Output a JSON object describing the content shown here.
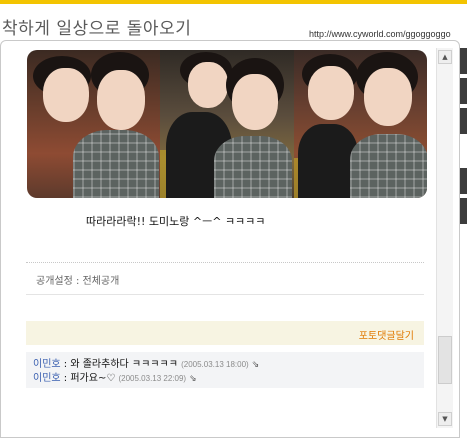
{
  "header": {
    "title": "착하게 일상으로 돌아오기",
    "url": "http://www.cyworld.com/ggoggoggo"
  },
  "post": {
    "caption": "따라라라락!! 도미노랑 ^ㅡ^ ㅋㅋㅋㅋ",
    "privacy": "공개설정 : 전체공개",
    "comment_link": "포토댓글달기"
  },
  "comments": [
    {
      "author": "이민호",
      "separator": " : ",
      "text": "와 졸라추하다 ㅋㅋㅋㅋㅋ",
      "date": "(2005.03.13 18:00)",
      "reply_icon": "⇘"
    },
    {
      "author": "이민호",
      "separator": " : ",
      "text": "퍼가요~♡",
      "date": "(2005.03.13 22:09)",
      "reply_icon": "⇘"
    }
  ],
  "scrollbar": {
    "up": "▲",
    "down": "▼"
  },
  "colors": {
    "accent": "#f3c400",
    "link": "#3a5fb0",
    "orange": "#e07800"
  }
}
